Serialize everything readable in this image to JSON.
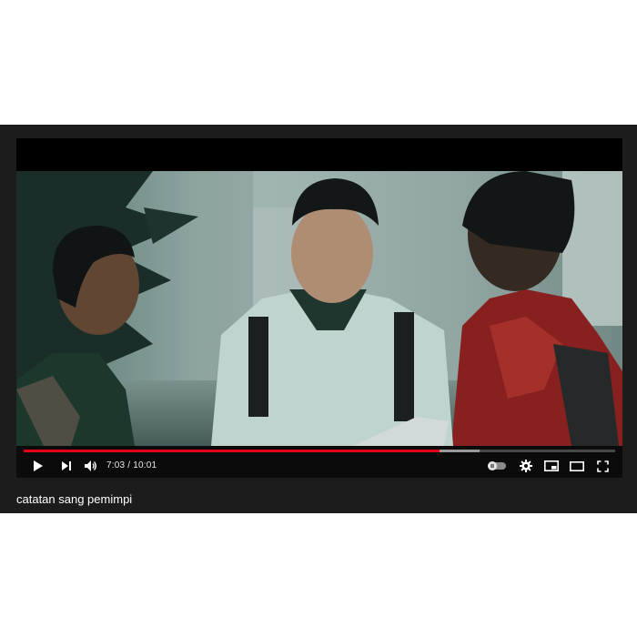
{
  "player": {
    "time_current": "7:03",
    "time_separator": " / ",
    "time_total": "10:01",
    "progress_played": 0.703,
    "progress_buffered": 0.77,
    "autoplay_on": false,
    "accent_color": "#e5001a"
  },
  "controls": {
    "icons": [
      "play-icon",
      "next-icon",
      "volume-icon",
      "autoplay-toggle-icon",
      "settings-icon",
      "miniplayer-icon",
      "theater-icon",
      "fullscreen-icon"
    ]
  },
  "video": {
    "title": "catatan sang pemimpi"
  }
}
